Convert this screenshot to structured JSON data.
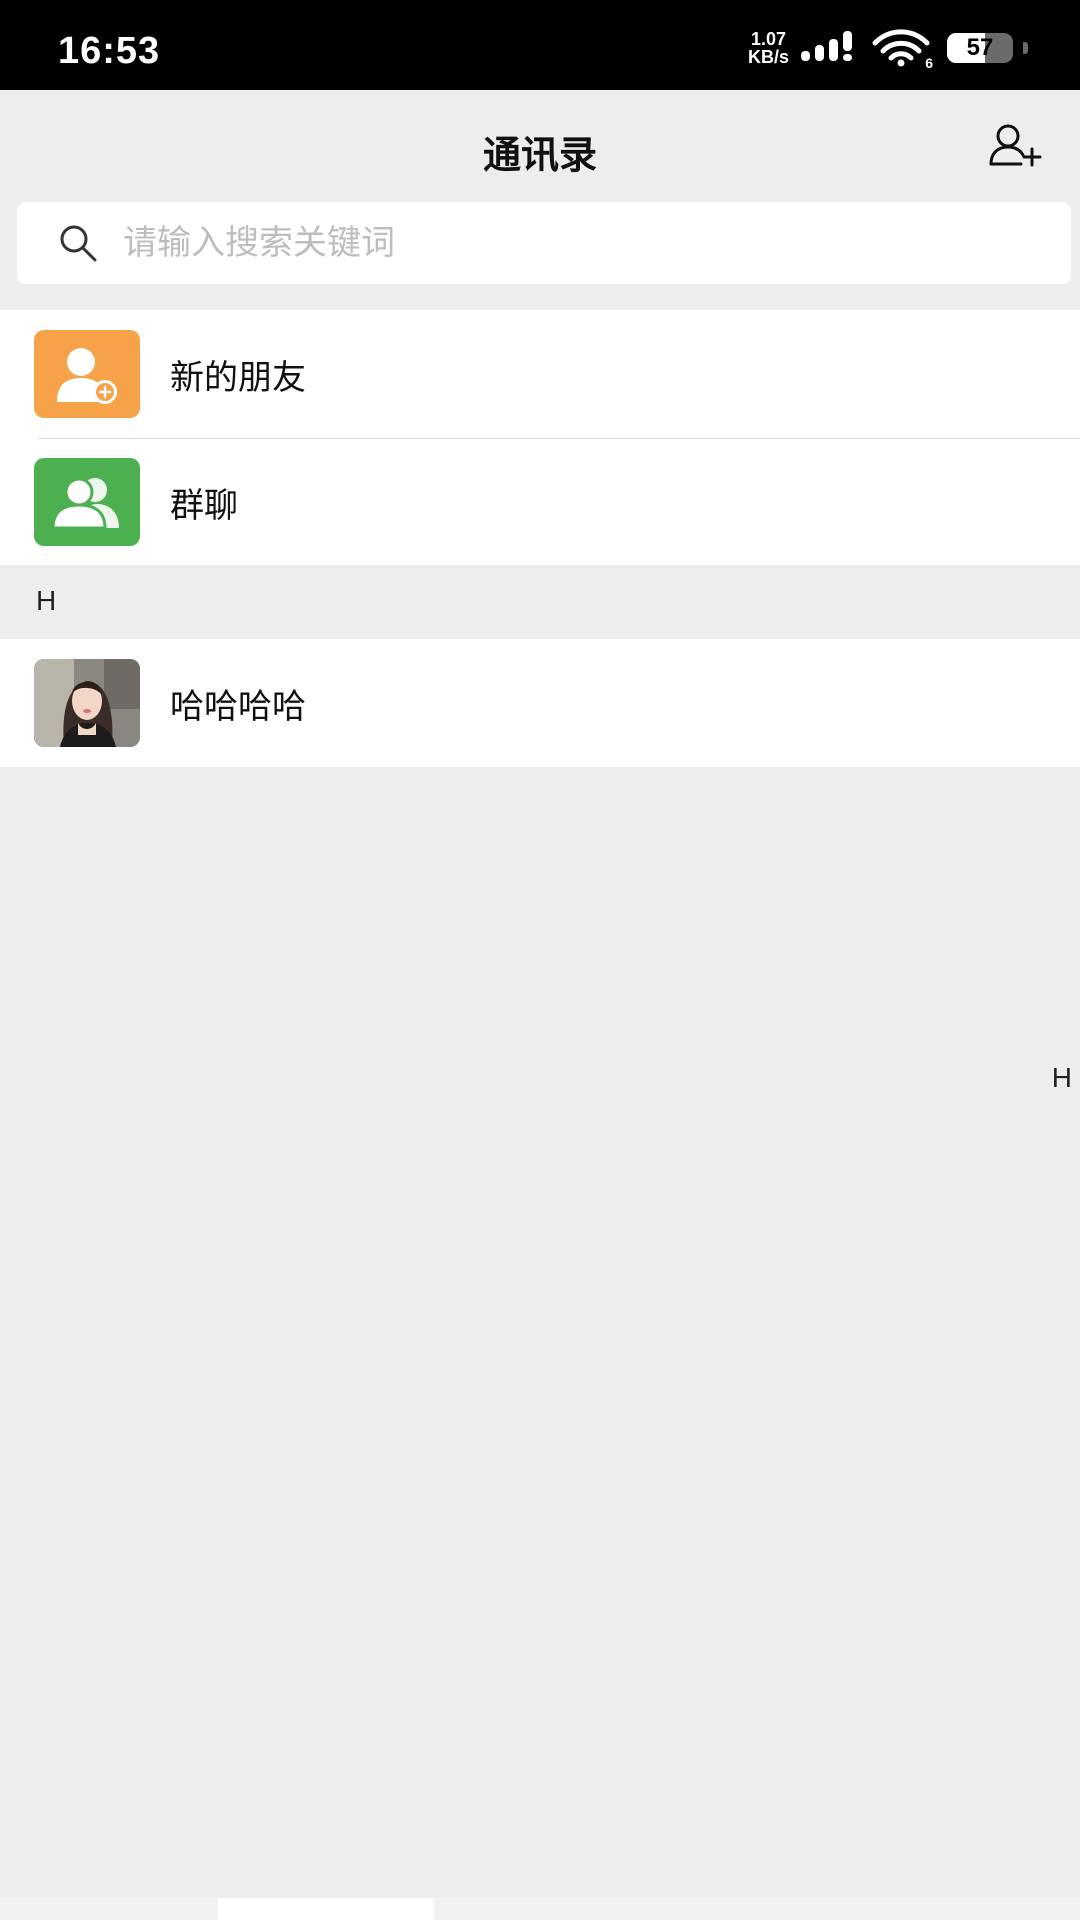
{
  "status_bar": {
    "time": "16:53",
    "net_speed_value": "1.07",
    "net_speed_unit": "KB/s",
    "wifi_badge": "6",
    "battery_level": "57"
  },
  "header": {
    "title": "通讯录"
  },
  "search": {
    "placeholder": "请输入搜索关键词"
  },
  "functions": [
    {
      "label": "新的朋友",
      "icon": "new-friend-icon",
      "color": "#f5a249"
    },
    {
      "label": "群聊",
      "icon": "group-chat-icon",
      "color": "#4caf50"
    }
  ],
  "contacts": {
    "index_letter": "H",
    "items": [
      {
        "name": "哈哈哈哈",
        "avatar": "contact-avatar"
      }
    ]
  },
  "side_index": {
    "letter": "H"
  },
  "colors": {
    "background": "#ededed",
    "orange": "#f5a249",
    "green": "#4caf50"
  }
}
